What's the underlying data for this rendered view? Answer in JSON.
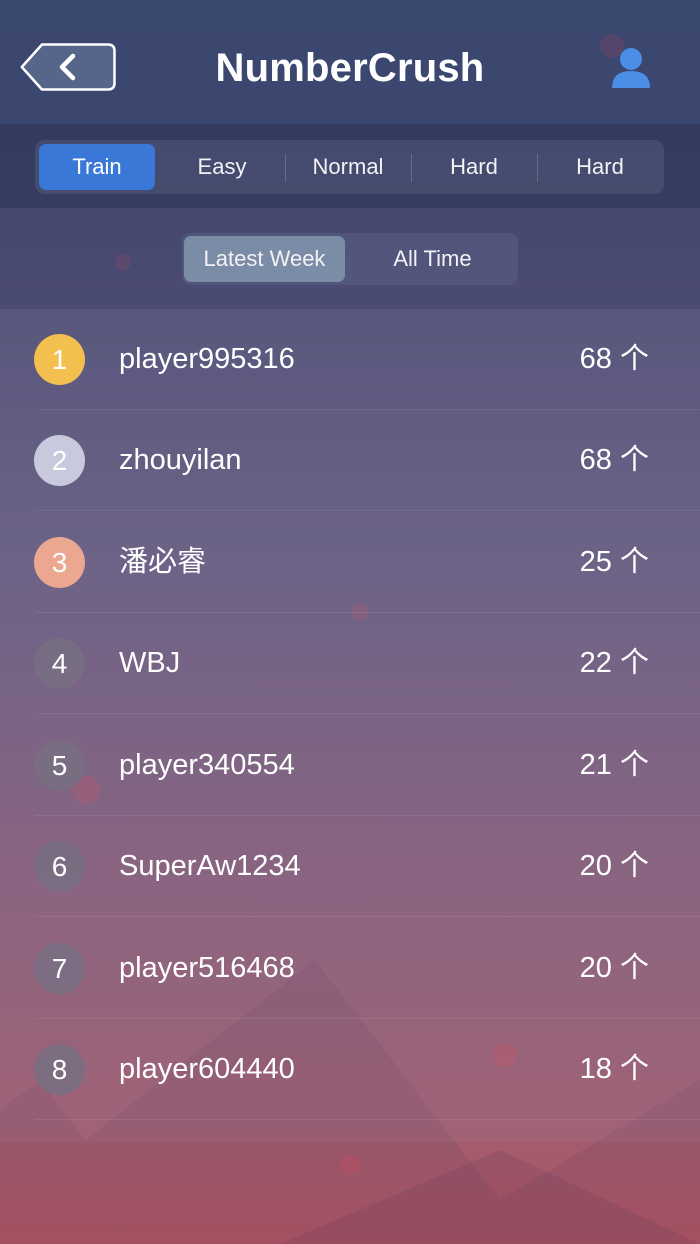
{
  "app": {
    "title": "NumberCrush"
  },
  "header": {
    "back_icon": "chevron-left-icon",
    "profile_icon": "person-icon"
  },
  "difficulty_tabs": [
    {
      "label": "Train",
      "active": true
    },
    {
      "label": "Easy",
      "active": false
    },
    {
      "label": "Normal",
      "active": false
    },
    {
      "label": "Hard",
      "active": false
    },
    {
      "label": "Hard",
      "active": false
    }
  ],
  "period_tabs": [
    {
      "label": "Latest Week",
      "active": true
    },
    {
      "label": "All Time",
      "active": false
    }
  ],
  "leaderboard": [
    {
      "rank": "1",
      "name": "player995316",
      "score": "68 个"
    },
    {
      "rank": "2",
      "name": "zhouyilan",
      "score": "68 个"
    },
    {
      "rank": "3",
      "name": "潘必睿",
      "score": "25 个"
    },
    {
      "rank": "4",
      "name": "WBJ",
      "score": "22 个"
    },
    {
      "rank": "5",
      "name": "player340554",
      "score": "21 个"
    },
    {
      "rank": "6",
      "name": "SuperAw1234",
      "score": "20 个"
    },
    {
      "rank": "7",
      "name": "player516468",
      "score": "20 个"
    },
    {
      "rank": "8",
      "name": "player604440",
      "score": "18 个"
    }
  ],
  "colors": {
    "accent": "#3a78d8",
    "period_active": "#7a8ca6",
    "gold": "#f3c04f",
    "silver": "#c8c9dc",
    "bronze": "#eba78f"
  }
}
